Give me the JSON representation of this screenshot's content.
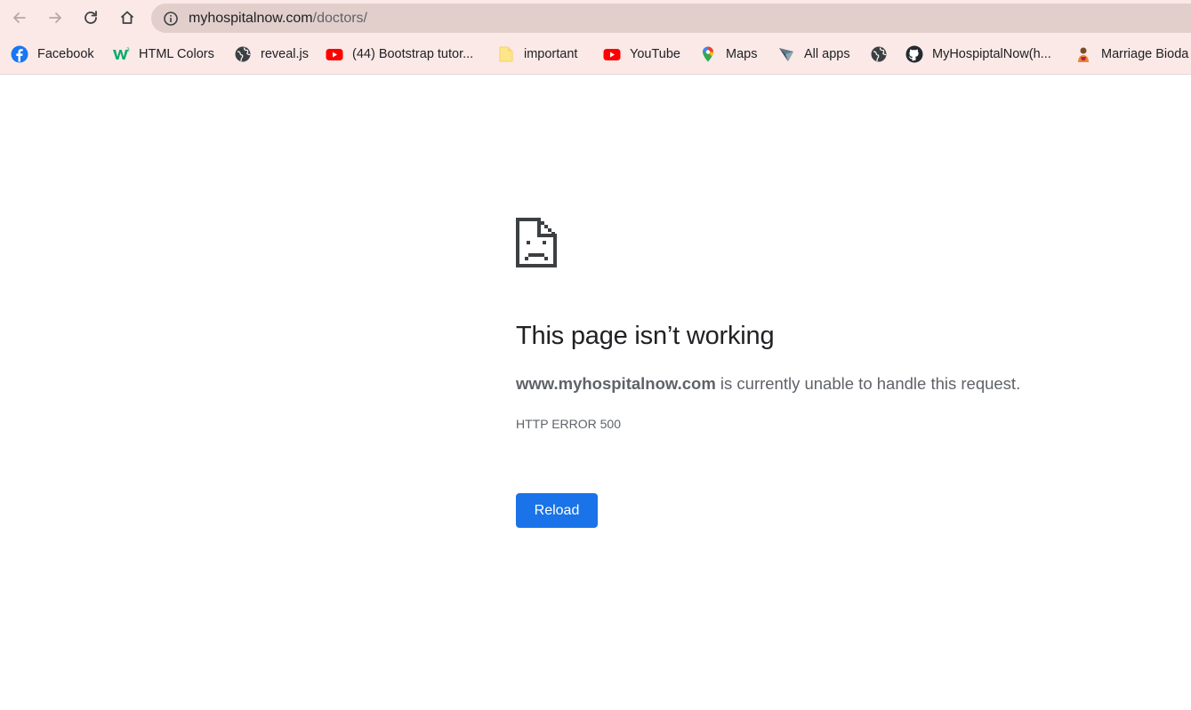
{
  "toolbar": {
    "back_icon": "arrow-left-icon",
    "forward_icon": "arrow-right-icon",
    "reload_icon": "reload-icon",
    "home_icon": "home-icon",
    "url_host": "myhospitalnow.com",
    "url_path": "/doctors/"
  },
  "bookmarks": [
    {
      "label": "Facebook",
      "icon": "facebook-icon"
    },
    {
      "label": "HTML Colors",
      "icon": "w3schools-icon"
    },
    {
      "label": "reveal.js",
      "icon": "globe-icon"
    },
    {
      "label": "(44) Bootstrap tutor...",
      "icon": "youtube-icon"
    },
    {
      "label": "important",
      "icon": "folder-icon"
    },
    {
      "label": "YouTube",
      "icon": "youtube-icon"
    },
    {
      "label": "Maps",
      "icon": "maps-pin-icon"
    },
    {
      "label": "All apps",
      "icon": "apps-icon"
    },
    {
      "label": "",
      "icon": "globe-icon"
    },
    {
      "label": "MyHospiptalNow(h...",
      "icon": "github-icon"
    },
    {
      "label": "Marriage Bioda",
      "icon": "person-icon"
    }
  ],
  "error": {
    "icon": "sad-page-icon",
    "title": "This page isn’t working",
    "domain": "www.myhospitalnow.com",
    "message": " is currently unable to handle this request.",
    "code": "HTTP ERROR 500",
    "reload_label": "Reload"
  },
  "colors": {
    "toolbar_bg": "#fbe9e7",
    "omnibox_bg": "#e2cfcc",
    "button_blue": "#1a73e8",
    "youtube_red": "#ff0000",
    "facebook_blue": "#1877f2"
  }
}
